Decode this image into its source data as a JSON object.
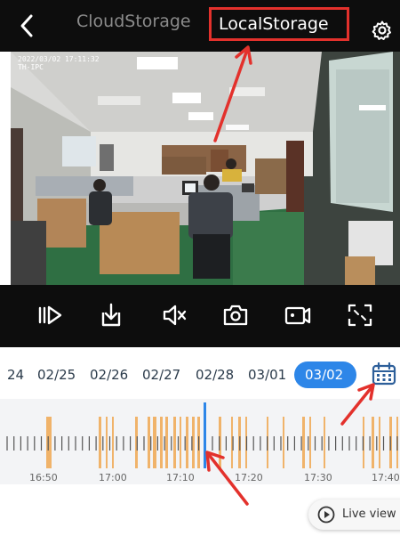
{
  "header": {
    "tabs": [
      {
        "label": "CloudStorage",
        "active": false
      },
      {
        "label": "LocalStorage",
        "active": true
      }
    ],
    "back_icon": "chevron-left-icon",
    "settings_icon": "gear-icon"
  },
  "video": {
    "osd_datetime": "2022/03/02 17:11:32",
    "osd_device": "TH-IPC"
  },
  "controls": [
    {
      "name": "play-icon"
    },
    {
      "name": "download-icon"
    },
    {
      "name": "mute-icon"
    },
    {
      "name": "snapshot-icon"
    },
    {
      "name": "record-icon"
    },
    {
      "name": "fullscreen-icon"
    }
  ],
  "dates": [
    "24",
    "02/25",
    "02/26",
    "02/27",
    "02/28",
    "03/01",
    "03/02"
  ],
  "selected_date": "03/02",
  "timeline": {
    "labels": [
      "16:50",
      "17:00",
      "17:10",
      "17:20",
      "17:30",
      "17:40"
    ],
    "current_time": "17:11"
  },
  "live_view": {
    "label": "Live view"
  },
  "colors": {
    "accent": "#2d86e8",
    "highlight": "#e3312c",
    "recording": "#f0b36a",
    "dark": "#0d0d0d"
  }
}
